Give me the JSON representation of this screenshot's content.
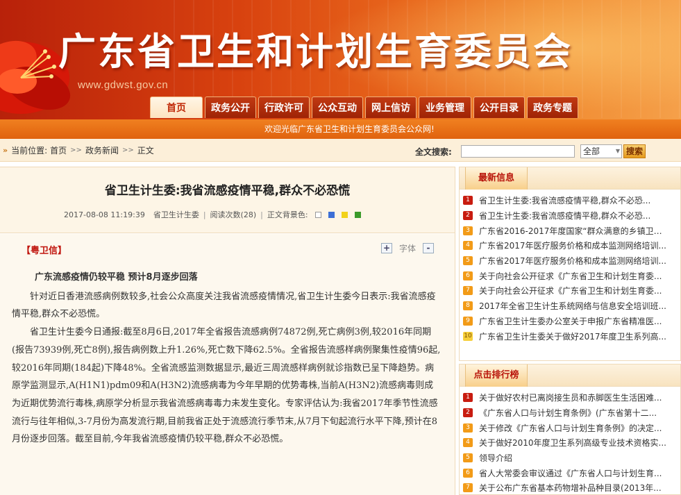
{
  "site": {
    "title": "广东省卫生和计划生育委员会",
    "url": "www.gdwst.gov.cn",
    "welcome": "欢迎光临广东省卫生和计划生育委员会公众网!"
  },
  "nav": {
    "items": [
      "首页",
      "政务公开",
      "行政许可",
      "公众互动",
      "网上信访",
      "业务管理",
      "公开目录",
      "政务专题"
    ]
  },
  "breadcrumb": {
    "label": "当前位置:",
    "items": [
      "首页",
      "政务新闻",
      "正文"
    ]
  },
  "search": {
    "label": "全文搜索:",
    "input_value": "",
    "scope": "全部",
    "button": "搜索"
  },
  "article": {
    "title": "省卫生计生委:我省流感疫情平稳,群众不必恐慌",
    "datetime": "2017-08-08 11:19:39",
    "source": "省卫生计生委",
    "views": "阅读次数(28)",
    "bg_label": "正文背景色:",
    "bg_colors": [
      "#ffffff",
      "#3c6fd6",
      "#f2d21a",
      "#3a9a2a"
    ],
    "tag": "【粤卫信】",
    "font_label": "字体",
    "font_plus": "+",
    "font_minus": "-",
    "subhead": "广东流感疫情仍较平稳 预计8月逐步回落",
    "paragraphs": [
      "针对近日香港流感病例数较多,社会公众高度关注我省流感疫情情况,省卫生计生委今日表示:我省流感疫情平稳,群众不必恐慌。",
      "省卫生计生委今日通报:截至8月6日,2017年全省报告流感病例74872例,死亡病例3例,较2016年同期(报告73939例,死亡8例),报告病例数上升1.26%,死亡数下降62.5%。全省报告流感样病例聚集性疫情96起,较2016年同期(184起)下降48%。全省流感监测数据显示,最近三周流感样病例就诊指数已呈下降趋势。病原学监测显示,A(H1N1)pdm09和A(H3N2)流感病毒为今年早期的优势毒株,当前A(H3N2)流感病毒则成为近期优势流行毒株,病原学分析显示我省流感病毒毒力未发生变化。专家评估认为:我省2017年季节性流感流行与往年相似,3-7月份为高发流行期,目前我省正处于流感流行季节末,从7月下旬起流行水平下降,预计在8月份逐步回落。截至目前,今年我省流感疫情仍较平稳,群众不必恐慌。"
    ]
  },
  "latest": {
    "title": "最新信息",
    "items": [
      "省卫生计生委:我省流感疫情平稳,群众不必恐...",
      "省卫生计生委:我省流感疫情平稳,群众不必恐...",
      "广东省2016-2017年度国家“群众满意的乡镇卫生...",
      "广东省2017年医疗服务价格和成本监测网络培训...",
      "广东省2017年医疗服务价格和成本监测网络培训...",
      "关于向社会公开征求《广东省卫生和计划生育委...",
      "关于向社会公开征求《广东省卫生和计划生育委...",
      "2017年全省卫生计生系统网络与信息安全培训班...",
      "广东省卫生计生委办公室关于申报广东省精准医...",
      "广东省卫生计生委关于做好2017年度卫生系列高..."
    ]
  },
  "hot": {
    "title": "点击排行榜",
    "items": [
      "关于做好农村已离岗接生员和赤脚医生生活困难...",
      "《广东省人口与计划生育条例》(广东省第十二...",
      "关于修改《广东省人口与计划生育条例》的决定...",
      "关于做好2010年度卫生系列高级专业技术资格实...",
      "领导介绍",
      "省人大常委会审议通过《广东省人口与计划生育...",
      "关于公布广东省基本药物增补品种目录(2013年..."
    ]
  }
}
